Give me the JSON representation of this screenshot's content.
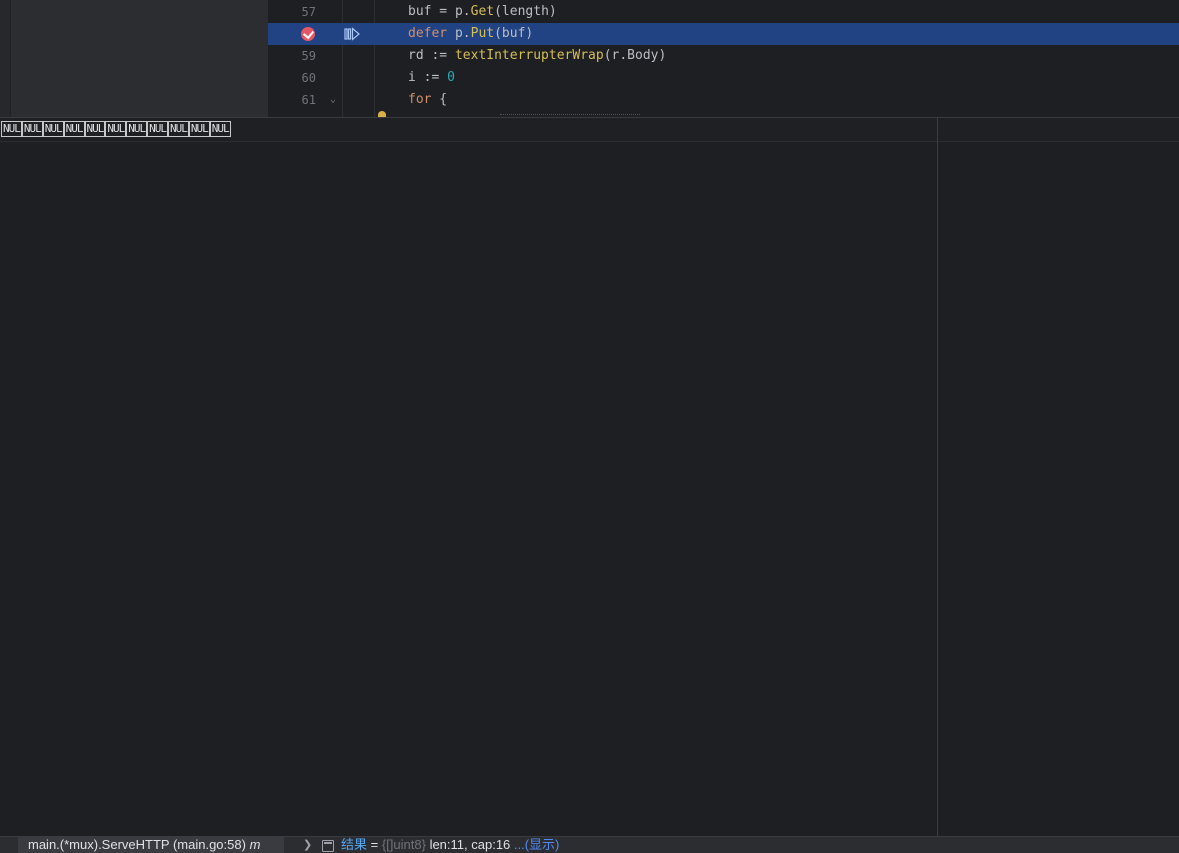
{
  "editor": {
    "lines": [
      {
        "num": "57",
        "parts": [
          "buf = p.",
          "Get",
          "(length)"
        ]
      },
      {
        "num": "58",
        "parts": [
          "defer",
          " p.",
          "Put",
          "(buf)"
        ]
      },
      {
        "num": "59",
        "parts": [
          "rd := ",
          "textInterrupterWrap",
          "(r.Body)"
        ]
      },
      {
        "num": "60",
        "parts": [
          "i := ",
          "0"
        ]
      },
      {
        "num": "61",
        "parts": [
          "for",
          " {"
        ]
      }
    ]
  },
  "panel": {
    "nul_tokens": [
      "NUL",
      "NUL",
      "NUL",
      "NUL",
      "NUL",
      "NUL",
      "NUL",
      "NUL",
      "NUL",
      "NUL",
      "NUL"
    ]
  },
  "status": {
    "frame_label": "main.(*mux).ServeHTTP (main.go:58)",
    "frame_suffix": "m",
    "var_name": "结果",
    "equals": " = ",
    "var_type": "{[]uint8}",
    "var_value": " len:11, cap:16 ",
    "show_link": "...(显示)"
  },
  "colors": {
    "highlight": "#214283",
    "breakpoint": "#e55765",
    "accent": "#56a8f5"
  }
}
